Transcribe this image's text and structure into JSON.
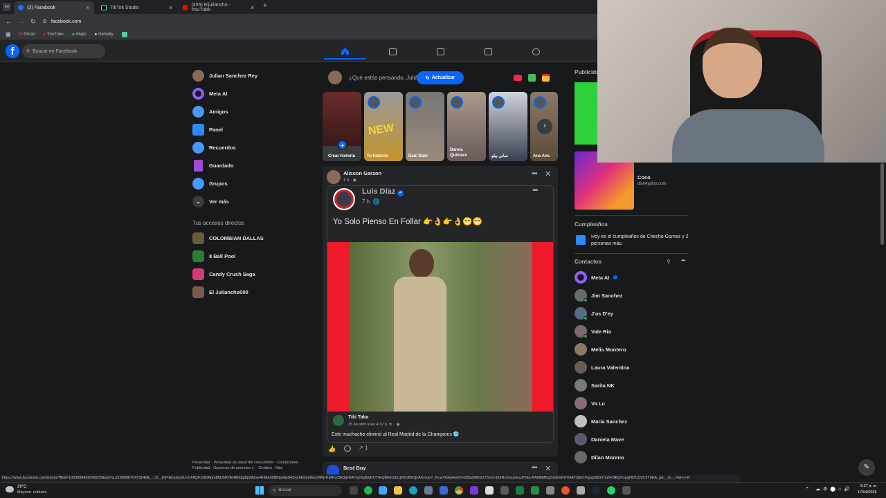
{
  "browser": {
    "tabs": [
      {
        "label": "(3) Facebook",
        "active": true,
        "color": "#1877f2"
      },
      {
        "label": "TikTok Studio",
        "active": false,
        "color": "#111111"
      },
      {
        "label": "(455) Eljuliancho - YouTube",
        "active": false,
        "color": "#ff0000"
      }
    ],
    "url": "facebook.com",
    "bookmarks": [
      "Gmail",
      "YouTube",
      "Maps",
      "Genially"
    ]
  },
  "header": {
    "logo": "f",
    "search_placeholder": "Buscar en Facebook"
  },
  "left_sidebar": {
    "items": [
      {
        "label": "Julian Sanchez Rey",
        "icon": "avatar",
        "color": "#8a6a5a"
      },
      {
        "label": "Meta AI",
        "icon": "meta-ai-icon",
        "color": "#a855f7"
      },
      {
        "label": "Amigos",
        "icon": "friends-icon",
        "color": "#4599ff"
      },
      {
        "label": "Panel",
        "icon": "dashboard-icon",
        "color": "#2d88ff"
      },
      {
        "label": "Recuerdos",
        "icon": "memories-icon",
        "color": "#4599ff"
      },
      {
        "label": "Guardado",
        "icon": "bookmark-icon",
        "color": "#a04cd8"
      },
      {
        "label": "Grupos",
        "icon": "groups-icon",
        "color": "#4599ff"
      },
      {
        "label": "Ver más",
        "icon": "chevron-down-icon",
        "color": "#3a3b3c"
      }
    ],
    "shortcuts_title": "Tus accesos directos",
    "shortcuts": [
      {
        "label": "COLOMBIAN DALLAS",
        "color": "#6b5a3a"
      },
      {
        "label": "8 Ball Pool",
        "color": "#2e7d32"
      },
      {
        "label": "Candy Crush Saga",
        "color": "#d23a7a"
      },
      {
        "label": "El Juliancho000",
        "color": "#7a5a4a"
      }
    ],
    "footer": "Privacidad · Privacidad de salud del consumidor · Condiciones · Publicidad · Opciones de anuncios ▷ · Cookies · Más"
  },
  "composer": {
    "placeholder": "¿Qué estás pensando, Julián?",
    "update_button": "Actualizar"
  },
  "stories": [
    {
      "label": "Crear historia"
    },
    {
      "label": "Tu historia"
    },
    {
      "label": "Dani Dani"
    },
    {
      "label": "Danna Quintero"
    },
    {
      "label": "ساني بيلو"
    },
    {
      "label": "Ans Ans"
    }
  ],
  "post": {
    "author": "Alisson Garzon",
    "time": "1 h · ",
    "shared_author": "Luis Díaz",
    "shared_time": "7 h",
    "text": "Yo Solo Pienso En Follar 👉👌👉👌😁😁",
    "source_name": "Tiki Taka",
    "source_date": "15 de abril a las 4:32 p. m. · ",
    "caption": "Este muchacho eliminó al Real Madrid de la Champions 🥶",
    "shares": "1"
  },
  "next_post": {
    "author": "Best Buy"
  },
  "right_sidebar": {
    "sponsored_title": "Publicidad",
    "ad_title": "Coco",
    "ad_domain": "disneyplus.com",
    "birthdays_title": "Cumpleaños",
    "birthday_text": "Hoy es el cumpleaños de Checho Gomez y 2 personas más.",
    "contacts_title": "Contactos",
    "contacts": [
      {
        "name": "Meta AI",
        "color": "#a855f7"
      },
      {
        "name": "Jim Sanchez",
        "color": "#6b6b6b"
      },
      {
        "name": "J'as D'ey",
        "color": "#5a6b8a"
      },
      {
        "name": "Vale Ria",
        "color": "#7a6a6a"
      },
      {
        "name": "Melis Montero",
        "color": "#8a7a6a"
      },
      {
        "name": "Laura Valentina",
        "color": "#6a5a5a"
      },
      {
        "name": "Sarita NK",
        "color": "#7a7a7a"
      },
      {
        "name": "Va Lu",
        "color": "#8a6a7a"
      },
      {
        "name": "Maria Sanchez",
        "color": "#c0c0c0"
      },
      {
        "name": "Daniela Mave",
        "color": "#5a5a6a"
      },
      {
        "name": "Dilan Moreno",
        "color": "#6a6a6a"
      }
    ]
  },
  "status_url": "https://www.facebook.com/photo/?fbid=1003099492043270&set=a.218800870473140&__cft__[0]=AZabuorU-XrNfQF1HOAdm86U5R2EHI8Xtjg8p9AZve4i-Ma42BKbo4p3HSnc6E52eWuo9WeTuBFvcBk8gHVKVg!Kp8IdKUY4rQBhdCtbCjPjIOBK3jkAXrvopY_FLw7k9wHedtYH25tuDiRiDZ75tn2-d83Ro9oxydeaJfVEs-PA8lbMKgOybbVKkYHAY3tlrX-Fgyg0BGYnIZ4-BEQVzpgNt7U1VC9T6EA_g&__tn__=EH-y-R",
  "taskbar": {
    "weather_temp": "26°C",
    "weather_desc": "Mayorm. nublado",
    "search_placeholder": "Buscar",
    "time": "9:27 p. m.",
    "date": "17/04/2026"
  }
}
